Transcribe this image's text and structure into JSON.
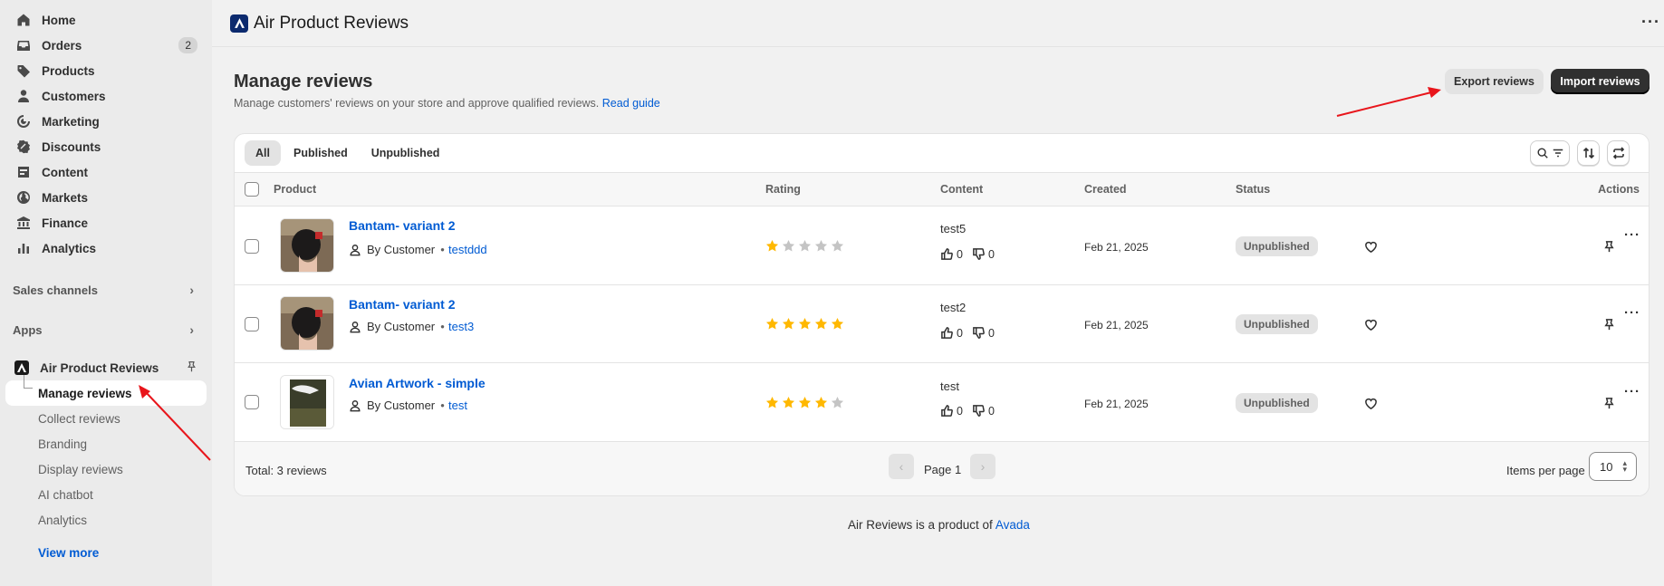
{
  "sidebar": {
    "items": [
      {
        "label": "Home",
        "icon": "home-icon"
      },
      {
        "label": "Orders",
        "icon": "inbox-icon",
        "badge": "2"
      },
      {
        "label": "Products",
        "icon": "tag-icon"
      },
      {
        "label": "Customers",
        "icon": "person-icon"
      },
      {
        "label": "Marketing",
        "icon": "target-icon"
      },
      {
        "label": "Discounts",
        "icon": "discount-icon"
      },
      {
        "label": "Content",
        "icon": "content-icon"
      },
      {
        "label": "Markets",
        "icon": "globe-icon"
      },
      {
        "label": "Finance",
        "icon": "bank-icon"
      },
      {
        "label": "Analytics",
        "icon": "chart-icon"
      }
    ],
    "sales_channels": "Sales channels",
    "apps": "Apps",
    "app_name": "Air Product Reviews",
    "app_sub_items": [
      "Manage reviews",
      "Collect reviews",
      "Branding",
      "Display reviews",
      "AI chatbot",
      "Analytics"
    ],
    "view_more": "View more"
  },
  "topbar": {
    "title": "Air Product Reviews",
    "more": "···"
  },
  "page": {
    "title": "Manage reviews",
    "subtitle": "Manage customers' reviews on your store and approve qualified reviews.",
    "guide_link": "Read guide",
    "export_label": "Export reviews",
    "import_label": "Import reviews"
  },
  "tabs": [
    "All",
    "Published",
    "Unpublished"
  ],
  "table": {
    "headers": {
      "product": "Product",
      "rating": "Rating",
      "content": "Content",
      "created": "Created",
      "status": "Status",
      "actions": "Actions"
    },
    "rows": [
      {
        "product": "Bantam- variant 2",
        "by": "By Customer",
        "author": "testddd",
        "rating": 1,
        "content": "test5",
        "likes": "0",
        "dislikes": "0",
        "created": "Feb 21, 2025",
        "status": "Unpublished"
      },
      {
        "product": "Bantam- variant 2",
        "by": "By Customer",
        "author": "test3",
        "rating": 5,
        "content": "test2",
        "likes": "0",
        "dislikes": "0",
        "created": "Feb 21, 2025",
        "status": "Unpublished"
      },
      {
        "product": "Avian Artwork - simple",
        "by": "By Customer",
        "author": "test",
        "rating": 4,
        "content": "test",
        "likes": "0",
        "dislikes": "0",
        "created": "Feb 21, 2025",
        "status": "Unpublished"
      }
    ]
  },
  "footer": {
    "total": "Total: 3 reviews",
    "page": "Page 1",
    "items_per_page_label": "Items per page",
    "items_per_page": "10"
  },
  "powered": {
    "text": "Air Reviews is a product of",
    "link": "Avada"
  },
  "colors": {
    "accent": "#005bd3",
    "star": "#ffb800",
    "star_empty": "#c4c4c4",
    "annotation": "#e8151b"
  }
}
